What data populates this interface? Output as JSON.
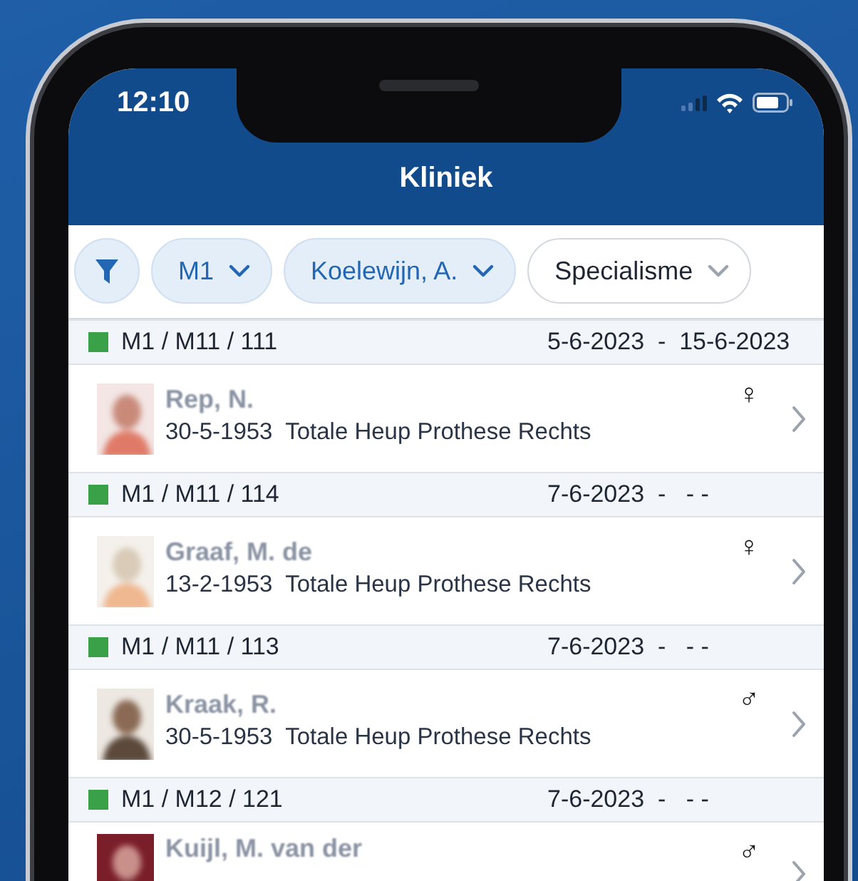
{
  "status_bar": {
    "time": "12:10"
  },
  "header": {
    "title": "Kliniek"
  },
  "filters": [
    {
      "kind": "icon",
      "active": true
    },
    {
      "kind": "chip",
      "label": "M1",
      "active": true
    },
    {
      "kind": "chip",
      "label": "Koelewijn, A.",
      "active": true
    },
    {
      "kind": "chip",
      "label": "Specialisme",
      "active": false
    }
  ],
  "groups": [
    {
      "location": "M1 / M11 / 111",
      "color": "#3aa148",
      "date_range": "5-6-2023  -  15-6-2023",
      "patient": {
        "name": "Rep, N.",
        "details": "30-5-1953  Totale Heup Prothese Rechts",
        "gender": "♀"
      }
    },
    {
      "location": "M1 / M11 / 114",
      "color": "#3aa148",
      "date_range": "7-6-2023  -   - -",
      "patient": {
        "name": "Graaf, M. de",
        "details": "13-2-1953  Totale Heup Prothese Rechts",
        "gender": "♀"
      }
    },
    {
      "location": "M1 / M11 / 113",
      "color": "#3aa148",
      "date_range": "7-6-2023  -   - -",
      "patient": {
        "name": "Kraak, R.",
        "details": "30-5-1953  Totale Heup Prothese Rechts",
        "gender": "♂"
      }
    },
    {
      "location": "M1 / M12 / 121",
      "color": "#3aa148",
      "date_range": "7-6-2023  -   - -",
      "patient": {
        "name": "Kuijl, M. van der",
        "gender": "♂"
      }
    }
  ]
}
